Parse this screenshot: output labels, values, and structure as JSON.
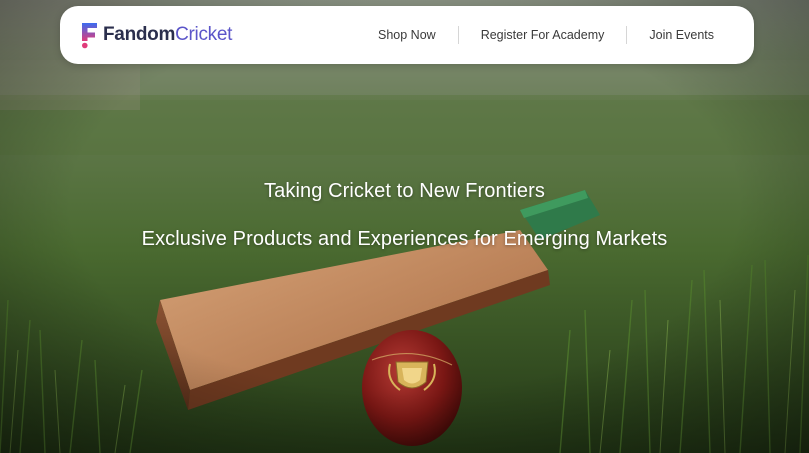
{
  "brand": {
    "name_part1": "Fandom",
    "name_part2": "Cricket",
    "mark_letter": "F"
  },
  "nav": {
    "links": [
      {
        "label": "Shop Now"
      },
      {
        "label": "Register For Academy"
      },
      {
        "label": "Join Events"
      }
    ]
  },
  "hero": {
    "line1": "Taking Cricket to New Frontiers",
    "line2": "Exclusive Products and Experiences for Emerging Markets"
  },
  "colors": {
    "nav_background": "#ffffff",
    "logo_text": "#2b2f4d",
    "logo_accent": "#5b55c9",
    "logo_gradient_start": "#3b6cf0",
    "logo_gradient_end": "#e03b7a",
    "headline_text": "#ffffff"
  }
}
